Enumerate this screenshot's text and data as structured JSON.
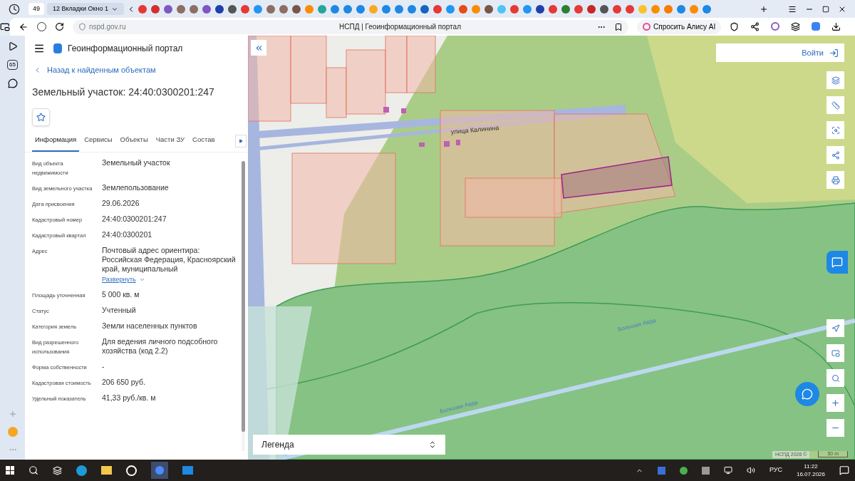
{
  "browser": {
    "tab_counter": "49",
    "tab_group": "12 Вкладки Окно 1",
    "url": "nspd.gov.ru",
    "page_title": "НСПД | Геоинформационный портал",
    "alice_button": "Спросить Алису AI",
    "sidebar_badge": "65"
  },
  "portal": {
    "title": "Геоинформационный портал",
    "back_link": "Назад к найденным объектам",
    "heading": "Земельный участок: 24:40:0300201:247",
    "favorite": false
  },
  "tabs": [
    {
      "label": "Информация",
      "selected": true
    },
    {
      "label": "Сервисы",
      "selected": false
    },
    {
      "label": "Объекты",
      "selected": false
    },
    {
      "label": "Части ЗУ",
      "selected": false
    },
    {
      "label": "Состав",
      "selected": false
    }
  ],
  "fields": [
    {
      "label": "Вид объекта недвижимости",
      "value": "Земельный участок"
    },
    {
      "label": "Вид земельного участка",
      "value": "Землепользование"
    },
    {
      "label": "Дата присвоения",
      "value": "29.06.2026"
    },
    {
      "label": "Кадастровый номер",
      "value": "24:40:0300201:247"
    },
    {
      "label": "Кадастровый квартал",
      "value": "24:40:0300201"
    },
    {
      "label": "Адрес",
      "value": "Почтовый адрес ориентира: Российская Федерация, Красноярский край, муниципальный",
      "expand_link": "Развернуть"
    },
    {
      "label": "Площадь уточненная",
      "value": "5 000 кв. м"
    },
    {
      "label": "Статус",
      "value": "Учтенный"
    },
    {
      "label": "Категория земель",
      "value": "Земли населенных пунктов"
    },
    {
      "label": "Вид разрешенного использования",
      "value": "Для ведения личного подсобного хозяйства (код 2.2)"
    },
    {
      "label": "Форма собственности",
      "value": "-"
    },
    {
      "label": "Кадастровая стоимость",
      "value": "206 650 руб."
    },
    {
      "label": "Удельный показатель",
      "value": "41,33 руб./кв. м"
    }
  ],
  "map": {
    "login": "Войти",
    "street_labels": [
      "улица Калинина",
      "Большая Авда",
      "Большая Авда"
    ],
    "legend": "Легенда",
    "attribution": "НСПД 2026 ©",
    "scale": "50 m"
  },
  "taskbar": {
    "language": "РУС",
    "time": "11:22",
    "date": "16.07.2026"
  }
}
